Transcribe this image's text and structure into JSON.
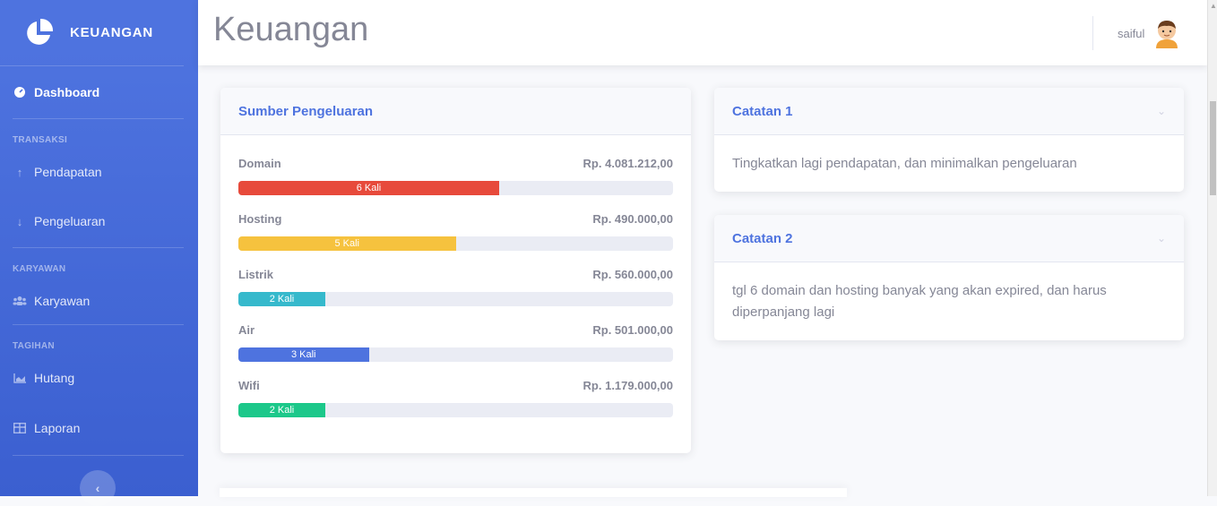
{
  "sidebar": {
    "brand": "KEUANGAN",
    "dashboard": "Dashboard",
    "section_transaksi": "TRANSAKSI",
    "pendapatan": "Pendapatan",
    "pengeluaran": "Pengeluaran",
    "section_karyawan": "KARYAWAN",
    "karyawan": "Karyawan",
    "section_tagihan": "TAGIHAN",
    "hutang": "Hutang",
    "laporan": "Laporan"
  },
  "topbar": {
    "title": "Keuangan",
    "username": "saiful"
  },
  "expenses": {
    "title": "Sumber Pengeluaran",
    "items": [
      {
        "name": "Domain",
        "amount": "Rp. 4.081.212,00",
        "count": "6 Kali",
        "fill": 60,
        "color": "#e74a3b"
      },
      {
        "name": "Hosting",
        "amount": "Rp. 490.000,00",
        "count": "5 Kali",
        "fill": 50,
        "color": "#f6c23e"
      },
      {
        "name": "Listrik",
        "amount": "Rp. 560.000,00",
        "count": "2 Kali",
        "fill": 20,
        "color": "#36b9cc"
      },
      {
        "name": "Air",
        "amount": "Rp. 501.000,00",
        "count": "3 Kali",
        "fill": 30,
        "color": "#4e73df"
      },
      {
        "name": "Wifi",
        "amount": "Rp. 1.179.000,00",
        "count": "2 Kali",
        "fill": 20,
        "color": "#1cc88a"
      }
    ]
  },
  "note1": {
    "title": "Catatan 1",
    "body": "Tingkatkan lagi pendapatan, dan minimalkan pengeluaran"
  },
  "note2": {
    "title": "Catatan 2",
    "body": "tgl 6 domain dan hosting banyak yang akan expired, dan harus diperpanjang lagi"
  }
}
